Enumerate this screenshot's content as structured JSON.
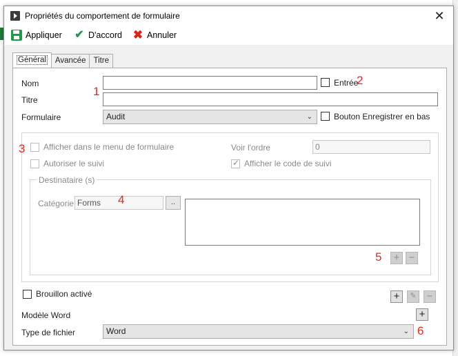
{
  "window": {
    "title": "Propriétés du comportement de formulaire",
    "close_glyph": "✕"
  },
  "toolbar": {
    "apply_label": "Appliquer",
    "ok_label": "D'accord",
    "cancel_label": "Annuler"
  },
  "tabs": [
    {
      "label": "Général",
      "active": true
    },
    {
      "label": "Avancée",
      "active": false
    },
    {
      "label": "Titre",
      "active": false
    }
  ],
  "form": {
    "nom_label": "Nom",
    "nom_value": "",
    "entree_label": "Entrée",
    "entree_checked": false,
    "titre_label": "Titre",
    "titre_value": "",
    "formulaire_label": "Formulaire",
    "formulaire_value": "Audit",
    "bouton_label": "Bouton Enregistrer en bas",
    "bouton_checked": false
  },
  "options": {
    "afficher_menu_label": "Afficher dans le menu de formulaire",
    "afficher_menu_checked": false,
    "autoriser_suivi_label": "Autoriser le suivi",
    "autoriser_suivi_checked": false,
    "voir_ordre_label": "Voir l'ordre",
    "voir_ordre_value": "0",
    "afficher_code_label": "Afficher le code de suivi",
    "afficher_code_checked": true
  },
  "destinataire": {
    "legend": "Destinataire (s)",
    "categorie_label": "Catégorie",
    "categorie_value": "Forms",
    "browse_label": "..",
    "add_glyph": "+",
    "remove_glyph": "−"
  },
  "bottom": {
    "brouillon_label": "Brouillon activé",
    "brouillon_checked": false,
    "modele_label": "Modèle Word",
    "type_fichier_label": "Type de fichier",
    "type_fichier_value": "Word",
    "add_glyph": "+",
    "edit_glyph": "✎",
    "remove_glyph": "−"
  },
  "annotations": [
    "1",
    "2",
    "3",
    "4",
    "5",
    "6"
  ],
  "colors": {
    "annotation": "#e8281c",
    "accent_green": "#1f9a4a",
    "cancel_red": "#d7261c"
  }
}
